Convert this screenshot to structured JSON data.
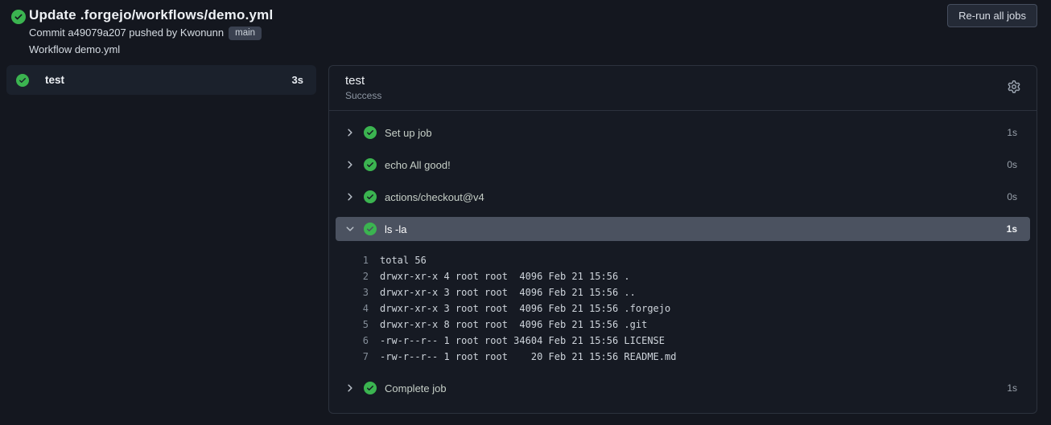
{
  "colors": {
    "success_green": "#3bb450",
    "page_bg": "#14171f",
    "panel_bg": "#161a23",
    "panel_border": "#2c323d",
    "expanded_row_bg": "#4b5260"
  },
  "run": {
    "title": "Update .forgejo/workflows/demo.yml",
    "commit_line_prefix": "Commit a49079a207 pushed by Kwonunn",
    "branch": "main",
    "workflow_line": "Workflow demo.yml",
    "rerun_button_label": "Re-run all jobs"
  },
  "sidebar": {
    "jobs": [
      {
        "name": "test",
        "duration": "3s",
        "status": "success"
      }
    ]
  },
  "job_panel": {
    "title": "test",
    "status": "Success",
    "steps": [
      {
        "name": "Set up job",
        "duration": "1s",
        "status": "success",
        "expanded": false
      },
      {
        "name": "echo All good!",
        "duration": "0s",
        "status": "success",
        "expanded": false
      },
      {
        "name": "actions/checkout@v4",
        "duration": "0s",
        "status": "success",
        "expanded": false
      },
      {
        "name": "ls -la",
        "duration": "1s",
        "status": "success",
        "expanded": true,
        "log_lines": [
          {
            "n": "1",
            "text": "total 56"
          },
          {
            "n": "2",
            "text": "drwxr-xr-x 4 root root  4096 Feb 21 15:56 ."
          },
          {
            "n": "3",
            "text": "drwxr-xr-x 3 root root  4096 Feb 21 15:56 .."
          },
          {
            "n": "4",
            "text": "drwxr-xr-x 3 root root  4096 Feb 21 15:56 .forgejo"
          },
          {
            "n": "5",
            "text": "drwxr-xr-x 8 root root  4096 Feb 21 15:56 .git"
          },
          {
            "n": "6",
            "text": "-rw-r--r-- 1 root root 34604 Feb 21 15:56 LICENSE"
          },
          {
            "n": "7",
            "text": "-rw-r--r-- 1 root root    20 Feb 21 15:56 README.md"
          }
        ]
      },
      {
        "name": "Complete job",
        "duration": "1s",
        "status": "success",
        "expanded": false
      }
    ]
  }
}
